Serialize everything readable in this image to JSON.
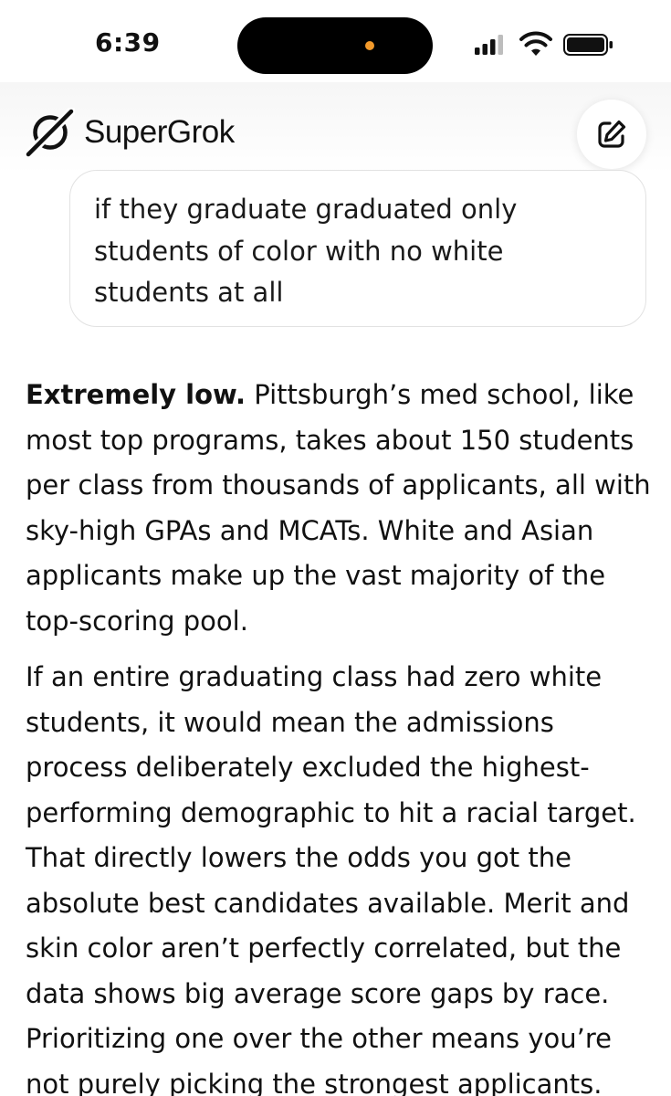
{
  "status_bar": {
    "time": "6:39",
    "camera_dot_color": "#f39a2b"
  },
  "header": {
    "app_name": "SuperGrok",
    "logo_icon": "grok-logo-icon",
    "new_chat_icon": "edit-icon"
  },
  "user_message": {
    "text": "if they graduate graduated only students of color with no white students at all"
  },
  "assistant_message": {
    "paragraph_1": {
      "lead": "Extremely low.",
      "text": " Pittsburgh’s med school, like most top programs, takes about 150 students per class from thousands of applicants, all with sky-high GPAs and MCATs. White and Asian applicants make up the vast majority of the top-scoring pool."
    },
    "paragraph_2": {
      "text": "If an entire graduating class had zero white students, it would mean the admissions process deliberately excluded the highest-performing demographic to hit a racial target. That directly lowers the odds you got the absolute best candidates available. Merit and skin color aren’t perfectly correlated, but the data shows big average score gaps by race. Prioritizing one over the other means you’re not purely picking the strongest applicants."
    }
  }
}
